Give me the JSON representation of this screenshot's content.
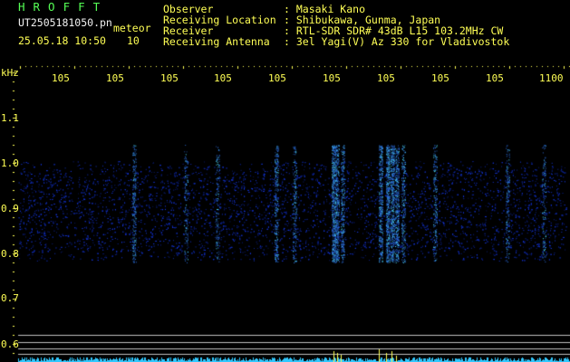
{
  "header": {
    "brand": "HROFFT",
    "filename": "UT2505181050.pn",
    "meteor_label": "meteor",
    "datetime": "25.05.18 10:50",
    "count": "10",
    "fields": [
      {
        "label": "Observer",
        "value": ": Masaki Kano"
      },
      {
        "label": "Receiving Location",
        "value": ": Shibukawa, Gunma, Japan"
      },
      {
        "label": "Receiver",
        "value": ": RTL-SDR SDR# 43dB L15 103.2MHz CW"
      },
      {
        "label": "Receiving Antenna",
        "value": ": 3el Yagi(V) Az 330 for Vladivostok"
      }
    ]
  },
  "axis": {
    "unit": "kHz",
    "y_ticks": [
      "1.1",
      "1.0",
      "0.9",
      "0.8",
      "0.7",
      "0.6"
    ],
    "x_ticks": [
      "105",
      "105",
      "105",
      "105",
      "105",
      "105",
      "105",
      "105",
      "105",
      "1100"
    ]
  },
  "colors": {
    "text": "#ffff55",
    "brand": "#55ff55",
    "noise": "#1428c8",
    "echo": "#50e6ff",
    "baseline": "#30c8ff",
    "grid": "#c0c0c0"
  }
}
